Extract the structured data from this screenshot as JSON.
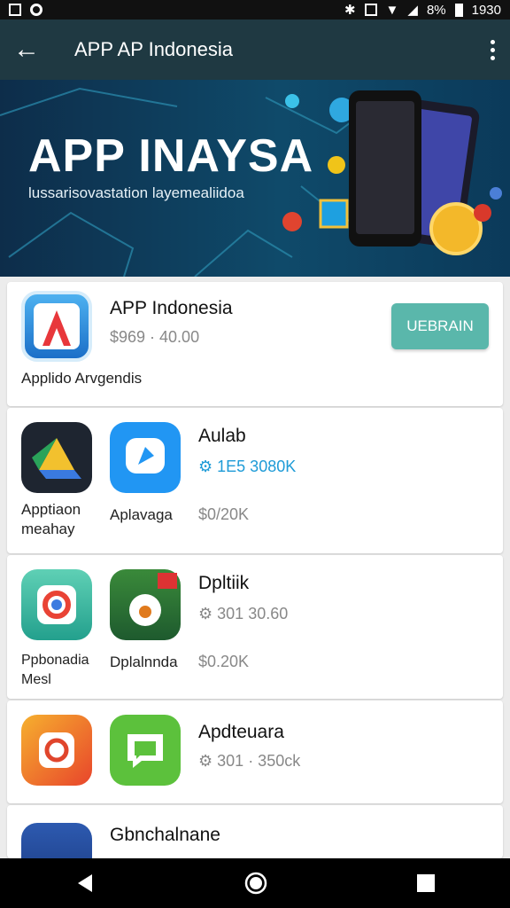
{
  "status_bar": {
    "battery": "8%",
    "time": "1930"
  },
  "app_bar": {
    "title": "APP AP Indonesia"
  },
  "banner": {
    "headline": "APP INAYSA",
    "subtitle": "lussarisovastation layemealiidoa"
  },
  "featured": {
    "name": "APP Indonesia",
    "meta": "$969 · 40.00",
    "label": "Applido Arvgendis",
    "button": "UEBRAIN"
  },
  "rows": [
    {
      "left_label": "Apptiaon meahay",
      "mid_label": "Aplavaga",
      "name": "Aulab",
      "meta": "1E5 3080K",
      "sub": "$0/20K"
    },
    {
      "left_label": "Ppbonadia Mesl",
      "mid_label": "Dplalnnda",
      "name": "Dpltiik",
      "meta": "301 30.60",
      "sub": "$0.20K"
    },
    {
      "name": "Apdteuara",
      "meta": "301 · 350ck"
    },
    {
      "name": "Gbnchalnane"
    }
  ],
  "nav": {
    "back": "back-icon",
    "home": "home-icon",
    "recents": "recents-icon"
  }
}
